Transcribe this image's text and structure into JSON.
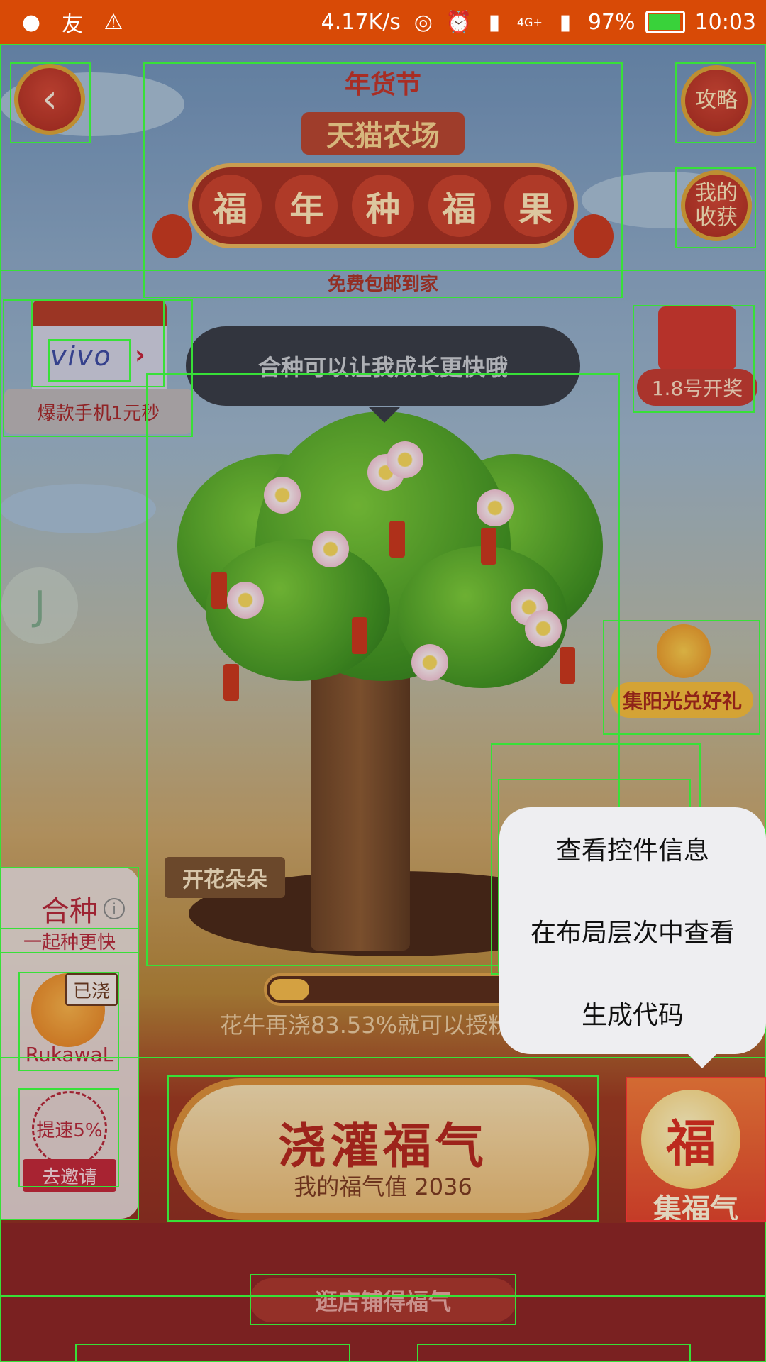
{
  "status_bar": {
    "net_speed": "4.17K/s",
    "network": "4G+",
    "battery": "97%",
    "time": "10:03"
  },
  "top": {
    "back_icon": "chevron-left-icon",
    "strategy": "攻略",
    "my_harvest": "我的收获"
  },
  "banner": {
    "festival": "年货节",
    "farm": "天猫农场",
    "slogan_chars": [
      "福",
      "年",
      "种",
      "福",
      "果"
    ],
    "subtitle": "免费包邮到家"
  },
  "promo_left": {
    "brand": "vivo",
    "caption": "爆款手机1元秒"
  },
  "promo_right": {
    "label": "1.8号开奖"
  },
  "tooltip": "合种可以让我成长更快哦",
  "tree": {
    "sign": "开花朵朵",
    "progress_text": "花牛再浇83.53%就可以授粉",
    "progress_fraction": 0.16
  },
  "sun_badge": "集阳光兑好礼",
  "left_panel": {
    "title": "合种",
    "subtitle": "一起种更快",
    "watered": "已浇",
    "username": "RukawaL",
    "speedup": "提速5%",
    "invite": "去邀请"
  },
  "water_button": {
    "title": "浇灌福气",
    "value_text": "我的福气值 2036"
  },
  "fu_card": {
    "char": "福",
    "label": "集福气"
  },
  "shop_button": "逛店铺得福气",
  "context_menu": [
    "查看控件信息",
    "在布局层次中查看",
    "生成代码"
  ],
  "colors": {
    "status_bar": "#d84a06",
    "outline": "#38e038",
    "accent_red": "#b3283a"
  }
}
